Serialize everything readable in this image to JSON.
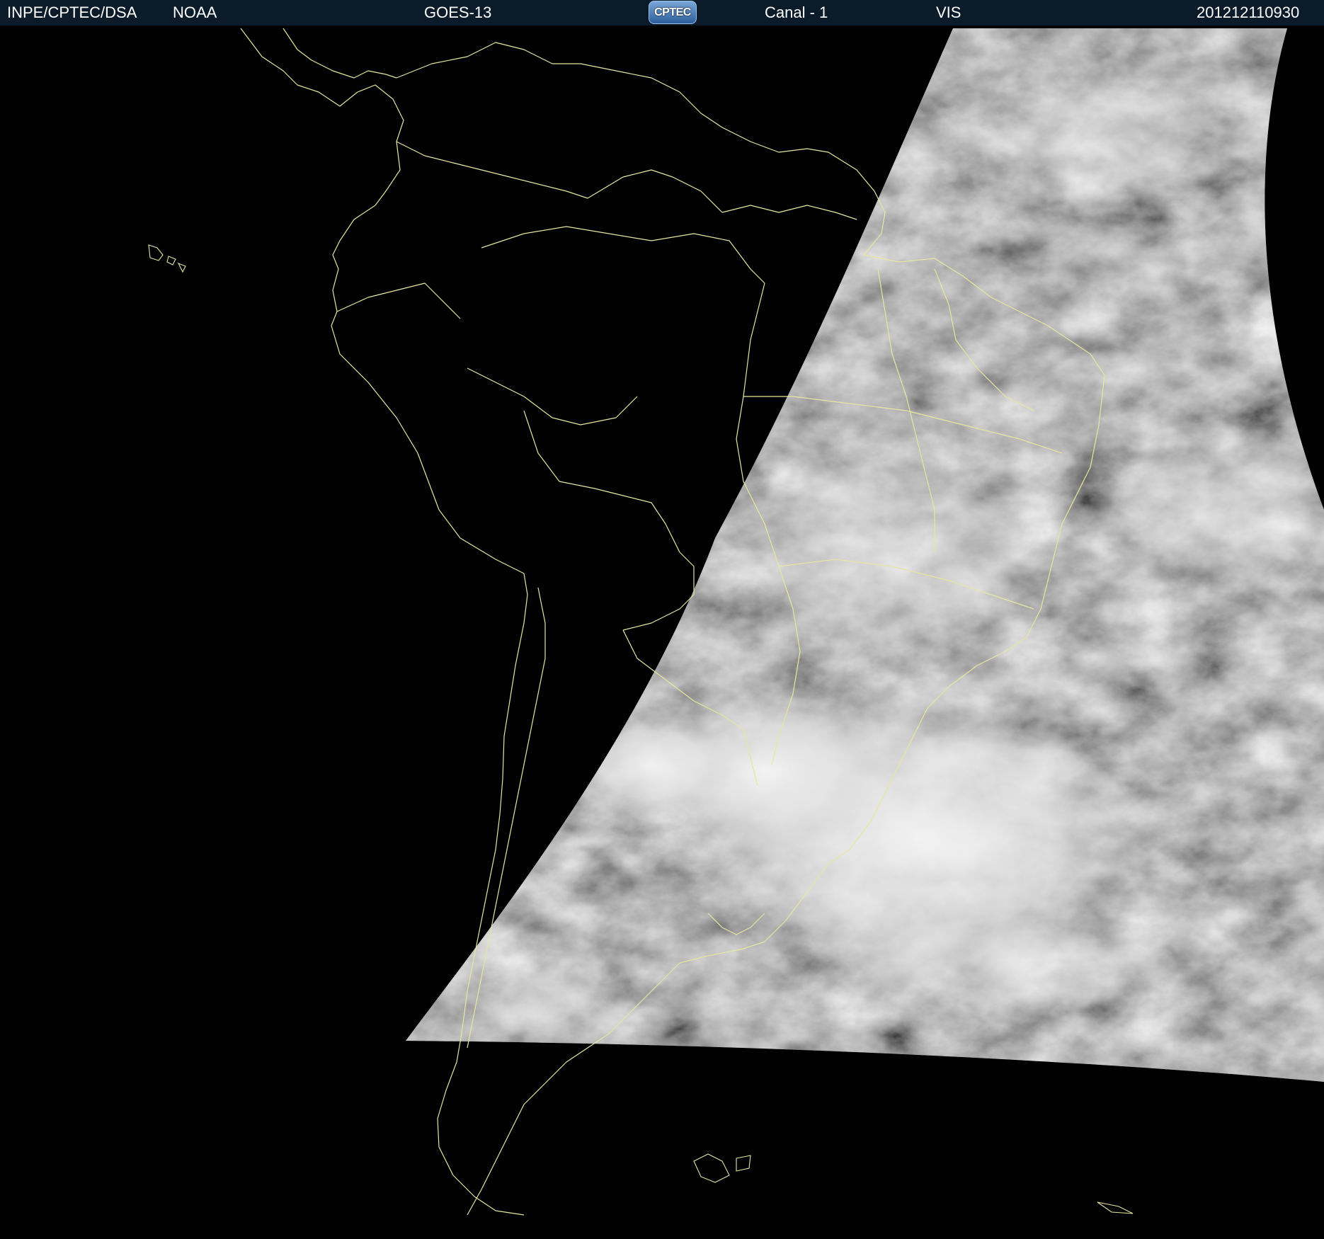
{
  "header": {
    "org": "INPE/CPTEC/DSA",
    "agency": "NOAA",
    "satellite": "GOES-13",
    "logo_text": "CPTEC",
    "channel": "Canal - 1",
    "band": "VIS",
    "timestamp": "201212110930"
  },
  "map": {
    "type": "satellite visible channel image",
    "colors": {
      "background": "#000000",
      "boundaries": "#e6e6a0",
      "header_bg": "#0b1b2a"
    }
  }
}
